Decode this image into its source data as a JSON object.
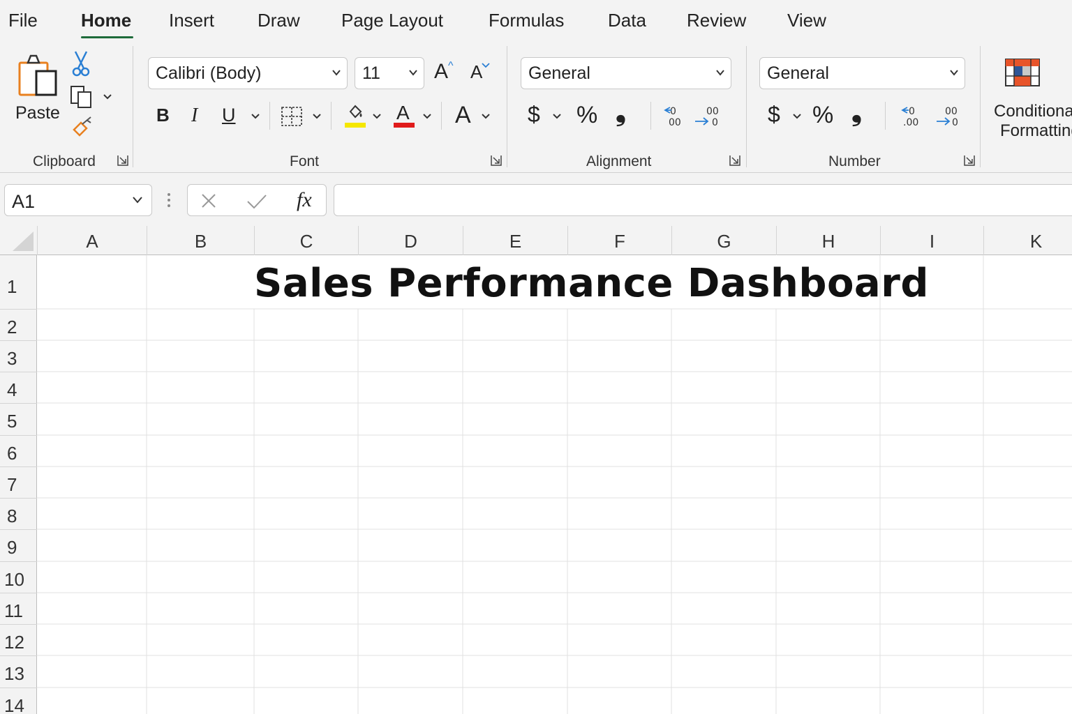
{
  "menu": {
    "tabs": [
      "File",
      "Home",
      "Insert",
      "Draw",
      "Page Layout",
      "Formulas",
      "Data",
      "Review",
      "View"
    ],
    "active": "Home"
  },
  "ribbon": {
    "clipboard": {
      "paste_label": "Paste",
      "group_label": "Clipboard"
    },
    "font": {
      "family": "Calibri (Body)",
      "size": "11",
      "group_label": "Font",
      "bold": "B",
      "italic": "I",
      "underline": "U",
      "font_color_glyph": "A",
      "grow": "A",
      "shrink": "A",
      "text_effects": "A",
      "highlight_color": "#f5e700",
      "font_color": "#e01b1b"
    },
    "alignment": {
      "format": "General",
      "group_label": "Alignment",
      "currency": "$",
      "percent": "%",
      "comma": "❟"
    },
    "number": {
      "format": "General",
      "group_label": "Number",
      "currency": "$",
      "percent": "%",
      "comma": "❟"
    },
    "conditional": {
      "line1": "Conditional",
      "line2": "Formatting"
    }
  },
  "formula_bar": {
    "name_box": "A1",
    "fx": "fx",
    "value": ""
  },
  "sheet": {
    "columns": [
      "A",
      "B",
      "C",
      "D",
      "E",
      "F",
      "G",
      "H",
      "I",
      "K"
    ],
    "rows": [
      "1",
      "2",
      "3",
      "4",
      "5",
      "6",
      "7",
      "8",
      "9",
      "10",
      "11",
      "12",
      "13",
      "14"
    ],
    "title": "Sales Performance Dashboard"
  }
}
